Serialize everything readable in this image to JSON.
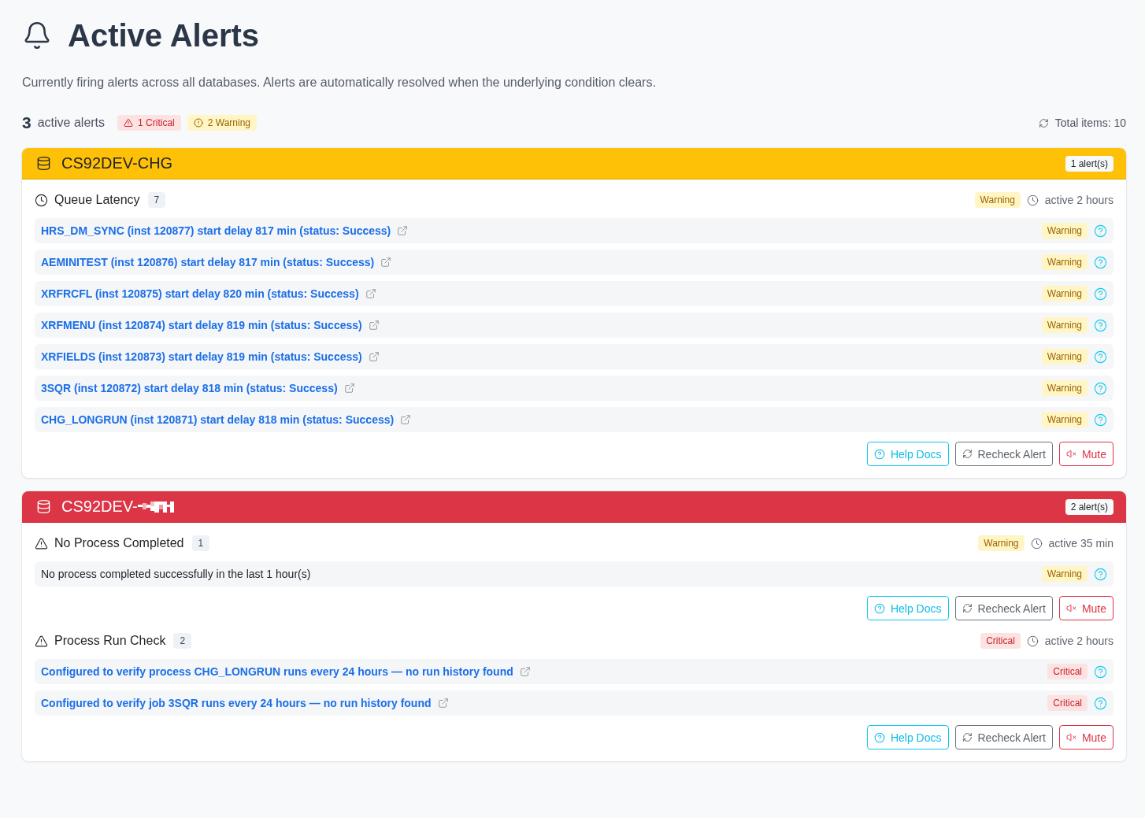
{
  "page": {
    "title": "Active Alerts",
    "description": "Currently firing alerts across all databases. Alerts are automatically resolved when the underlying condition clears."
  },
  "summary": {
    "count": "3",
    "label": "active alerts",
    "badges": [
      {
        "kind": "critical",
        "label": "1 Critical"
      },
      {
        "kind": "warning",
        "label": "2 Warning"
      }
    ],
    "total": "Total items: 10"
  },
  "databases": [
    {
      "kind": "warning",
      "name": "CS92DEV-CHG",
      "name_redacted": false,
      "alert_count": "1 alert(s)",
      "groups": [
        {
          "kind": "latency",
          "title": "Queue Latency",
          "count": "7",
          "badge": {
            "kind": "warning",
            "label": "Warning"
          },
          "active": "active 2 hours",
          "items": [
            {
              "kind": "link",
              "text": "HRS_DM_SYNC (inst 120877) start delay 817 min (status: Success)",
              "badge": {
                "kind": "warning",
                "label": "Warning"
              }
            },
            {
              "kind": "link",
              "text": "AEMINITEST (inst 120876) start delay 817 min (status: Success)",
              "badge": {
                "kind": "warning",
                "label": "Warning"
              }
            },
            {
              "kind": "link",
              "text": "XRFRCFL (inst 120875) start delay 820 min (status: Success)",
              "badge": {
                "kind": "warning",
                "label": "Warning"
              }
            },
            {
              "kind": "link",
              "text": "XRFMENU (inst 120874) start delay 819 min (status: Success)",
              "badge": {
                "kind": "warning",
                "label": "Warning"
              }
            },
            {
              "kind": "link",
              "text": "XRFIELDS (inst 120873) start delay 819 min (status: Success)",
              "badge": {
                "kind": "warning",
                "label": "Warning"
              }
            },
            {
              "kind": "link",
              "text": "3SQR (inst 120872) start delay 818 min (status: Success)",
              "badge": {
                "kind": "warning",
                "label": "Warning"
              }
            },
            {
              "kind": "link",
              "text": "CHG_LONGRUN (inst 120871) start delay 818 min (status: Success)",
              "badge": {
                "kind": "warning",
                "label": "Warning"
              }
            }
          ],
          "actions": [
            {
              "kind": "help",
              "label": "Help Docs"
            },
            {
              "kind": "recheck",
              "label": "Recheck Alert"
            },
            {
              "kind": "mute",
              "label": "Mute"
            }
          ]
        }
      ]
    },
    {
      "kind": "critical",
      "name": "CS92DEV-",
      "name_redacted": true,
      "alert_count": "2 alert(s)",
      "groups": [
        {
          "kind": "process",
          "title": "No Process Completed",
          "count": "1",
          "badge": {
            "kind": "warning",
            "label": "Warning"
          },
          "active": "active 35 min",
          "items": [
            {
              "kind": "text",
              "text": "No process completed successfully in the last 1 hour(s)",
              "badge": {
                "kind": "warning",
                "label": "Warning"
              }
            }
          ],
          "actions": [
            {
              "kind": "help",
              "label": "Help Docs"
            },
            {
              "kind": "recheck",
              "label": "Recheck Alert"
            },
            {
              "kind": "mute",
              "label": "Mute"
            }
          ]
        },
        {
          "kind": "process",
          "title": "Process Run Check",
          "count": "2",
          "badge": {
            "kind": "critical",
            "label": "Critical"
          },
          "active": "active 2 hours",
          "items": [
            {
              "kind": "link",
              "text": "Configured to verify process CHG_LONGRUN runs every 24 hours — no run history found",
              "badge": {
                "kind": "critical",
                "label": "Critical"
              }
            },
            {
              "kind": "link",
              "text": "Configured to verify job 3SQR runs every 24 hours — no run history found",
              "badge": {
                "kind": "critical",
                "label": "Critical"
              }
            }
          ],
          "actions": [
            {
              "kind": "help",
              "label": "Help Docs"
            },
            {
              "kind": "recheck",
              "label": "Recheck Alert"
            },
            {
              "kind": "mute",
              "label": "Mute"
            }
          ]
        }
      ]
    }
  ]
}
